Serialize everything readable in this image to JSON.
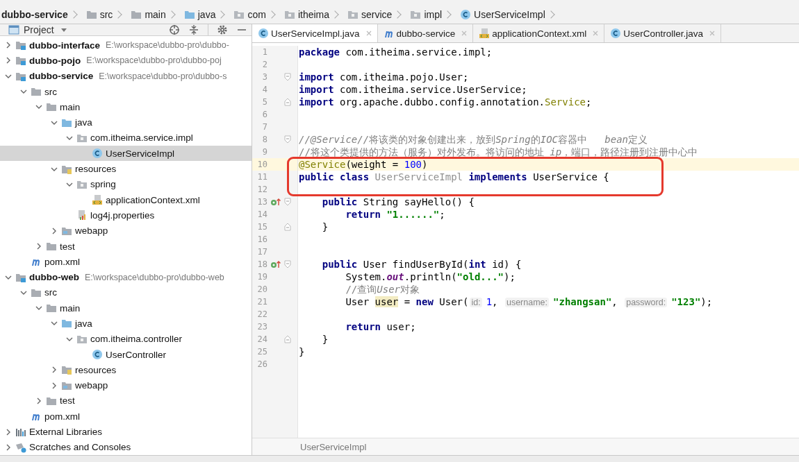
{
  "breadcrumb": [
    {
      "label": "dubbo-service",
      "kind": "module"
    },
    {
      "label": "src",
      "kind": "folder"
    },
    {
      "label": "main",
      "kind": "folder"
    },
    {
      "label": "java",
      "kind": "source"
    },
    {
      "label": "com",
      "kind": "package"
    },
    {
      "label": "itheima",
      "kind": "package"
    },
    {
      "label": "service",
      "kind": "package"
    },
    {
      "label": "impl",
      "kind": "package"
    },
    {
      "label": "UserServiceImpl",
      "kind": "class"
    }
  ],
  "project_panel": {
    "title": "Project",
    "tree": [
      {
        "name": "dubbo-interface",
        "path": "E:\\workspace\\dubbo-pro\\dubbo-",
        "kind": "module",
        "expanded": false,
        "selected": false
      },
      {
        "name": "dubbo-pojo",
        "path": "E:\\workspace\\dubbo-pro\\dubbo-poj",
        "kind": "module",
        "expanded": false,
        "selected": false
      },
      {
        "name": "dubbo-service",
        "path": "E:\\workspace\\dubbo-pro\\dubbo-s",
        "kind": "module",
        "expanded": true,
        "selected": false,
        "children": [
          {
            "name": "src",
            "kind": "folder",
            "expanded": true,
            "selected": false,
            "children": [
              {
                "name": "main",
                "kind": "folder",
                "expanded": true,
                "selected": false,
                "children": [
                  {
                    "name": "java",
                    "kind": "source",
                    "expanded": true,
                    "selected": false,
                    "children": [
                      {
                        "name": "com.itheima.service.impl",
                        "kind": "package",
                        "expanded": true,
                        "selected": false,
                        "children": [
                          {
                            "name": "UserServiceImpl",
                            "kind": "class",
                            "selected": true
                          }
                        ]
                      }
                    ]
                  },
                  {
                    "name": "resources",
                    "kind": "resources",
                    "expanded": true,
                    "selected": false,
                    "children": [
                      {
                        "name": "spring",
                        "kind": "package",
                        "expanded": true,
                        "selected": false,
                        "children": [
                          {
                            "name": "applicationContext.xml",
                            "kind": "xml",
                            "selected": false
                          }
                        ]
                      },
                      {
                        "name": "log4j.properties",
                        "kind": "properties",
                        "selected": false
                      }
                    ]
                  },
                  {
                    "name": "webapp",
                    "kind": "web",
                    "expanded": false,
                    "selected": false
                  }
                ]
              },
              {
                "name": "test",
                "kind": "folder",
                "expanded": false,
                "selected": false
              }
            ]
          },
          {
            "name": "pom.xml",
            "kind": "maven",
            "selected": false
          }
        ]
      },
      {
        "name": "dubbo-web",
        "path": "E:\\workspace\\dubbo-pro\\dubbo-web",
        "kind": "module",
        "expanded": true,
        "selected": false,
        "children": [
          {
            "name": "src",
            "kind": "folder",
            "expanded": true,
            "selected": false,
            "children": [
              {
                "name": "main",
                "kind": "folder",
                "expanded": true,
                "selected": false,
                "children": [
                  {
                    "name": "java",
                    "kind": "source",
                    "expanded": true,
                    "selected": false,
                    "children": [
                      {
                        "name": "com.itheima.controller",
                        "kind": "package",
                        "expanded": true,
                        "selected": false,
                        "children": [
                          {
                            "name": "UserController",
                            "kind": "class",
                            "selected": false
                          }
                        ]
                      }
                    ]
                  },
                  {
                    "name": "resources",
                    "kind": "resources",
                    "expanded": false,
                    "selected": false
                  },
                  {
                    "name": "webapp",
                    "kind": "web",
                    "expanded": false,
                    "selected": false
                  }
                ]
              },
              {
                "name": "test",
                "kind": "folder",
                "expanded": false,
                "selected": false
              }
            ]
          },
          {
            "name": "pom.xml",
            "kind": "maven",
            "selected": false
          }
        ]
      },
      {
        "name": "External Libraries",
        "kind": "libraries",
        "expanded": false,
        "selected": false
      },
      {
        "name": "Scratches and Consoles",
        "kind": "scratches",
        "expanded": false,
        "selected": false
      }
    ]
  },
  "tabs": [
    {
      "label": "UserServiceImpl.java",
      "kind": "class",
      "selected": true
    },
    {
      "label": "dubbo-service",
      "kind": "maven",
      "selected": false
    },
    {
      "label": "applicationContext.xml",
      "kind": "xml",
      "selected": false
    },
    {
      "label": "UserController.java",
      "kind": "class",
      "selected": false
    }
  ],
  "code": {
    "lines": [
      {
        "number": "1",
        "tokens": [
          {
            "kind": "kw",
            "text": "package"
          },
          {
            "kind": "plain",
            "text": " com.itheima.service.impl;"
          }
        ]
      },
      {
        "number": "2"
      },
      {
        "number": "3",
        "fold_start": true,
        "tokens": [
          {
            "kind": "kw",
            "text": "import"
          },
          {
            "kind": "plain",
            "text": " com.itheima.pojo.User;"
          }
        ]
      },
      {
        "number": "4",
        "tokens": [
          {
            "kind": "kw",
            "text": "import"
          },
          {
            "kind": "plain",
            "text": " com.itheima.service.UserService;"
          }
        ]
      },
      {
        "number": "5",
        "fold_end": true,
        "tokens": [
          {
            "kind": "kw",
            "text": "import"
          },
          {
            "kind": "plain",
            "text": " org.apache.dubbo.config.annotation."
          },
          {
            "kind": "ann",
            "text": "Service"
          },
          {
            "kind": "plain",
            "text": ";"
          }
        ]
      },
      {
        "number": "6"
      },
      {
        "number": "7"
      },
      {
        "number": "8",
        "fold_start": true,
        "tokens": [
          {
            "kind": "comment_em",
            "text": "//@Service//"
          },
          {
            "kind": "comment",
            "text": "将该类的对象创建出来，放到"
          },
          {
            "kind": "comment_em",
            "text": "Spring"
          },
          {
            "kind": "comment",
            "text": "的"
          },
          {
            "kind": "comment_em",
            "text": "IOC"
          },
          {
            "kind": "comment",
            "text": "容器中   "
          },
          {
            "kind": "comment_em",
            "text": "bean"
          },
          {
            "kind": "comment",
            "text": "定义"
          }
        ]
      },
      {
        "number": "9",
        "tokens": [
          {
            "kind": "comment",
            "text": "//将这个类提供的方法（服务）对外发布。将访问的地址 "
          },
          {
            "kind": "comment_em",
            "text": "ip"
          },
          {
            "kind": "comment",
            "text": "，端口，路径注册到注册中心中"
          }
        ]
      },
      {
        "number": "10",
        "current": true,
        "tokens": [
          {
            "kind": "ann",
            "text": "@Service"
          },
          {
            "kind": "plain",
            "text": "(weight = "
          },
          {
            "kind": "num",
            "text": "100"
          },
          {
            "kind": "plain",
            "text": ")"
          }
        ]
      },
      {
        "number": "11",
        "tokens": [
          {
            "kind": "kw",
            "text": "public class "
          },
          {
            "kind": "unused",
            "text": "UserServiceImpl "
          },
          {
            "kind": "kw",
            "text": "implements"
          },
          {
            "kind": "plain",
            "text": " UserService {"
          }
        ]
      },
      {
        "number": "12"
      },
      {
        "number": "13",
        "implements": true,
        "fold_start": true,
        "tokens": [
          {
            "kind": "kw",
            "text": "    public"
          },
          {
            "kind": "plain",
            "text": " String sayHello() {"
          }
        ]
      },
      {
        "number": "14",
        "tokens": [
          {
            "kind": "kw",
            "text": "        return "
          },
          {
            "kind": "str",
            "text": "\"1......\""
          },
          {
            "kind": "plain",
            "text": ";"
          }
        ]
      },
      {
        "number": "15",
        "fold_end": true,
        "tokens": [
          {
            "kind": "plain",
            "text": "    }"
          }
        ]
      },
      {
        "number": "16"
      },
      {
        "number": "17"
      },
      {
        "number": "18",
        "implements": true,
        "fold_start": true,
        "tokens": [
          {
            "kind": "kw",
            "text": "    public"
          },
          {
            "kind": "plain",
            "text": " User findUserById("
          },
          {
            "kind": "kw",
            "text": "int"
          },
          {
            "kind": "plain",
            "text": " id) {"
          }
        ]
      },
      {
        "number": "19",
        "tokens": [
          {
            "kind": "plain",
            "text": "        System."
          },
          {
            "kind": "field",
            "text": "out"
          },
          {
            "kind": "plain",
            "text": ".println("
          },
          {
            "kind": "str",
            "text": "\"old...\""
          },
          {
            "kind": "plain",
            "text": ");"
          }
        ]
      },
      {
        "number": "20",
        "tokens": [
          {
            "kind": "comment",
            "text": "        //查询"
          },
          {
            "kind": "comment_em",
            "text": "User"
          },
          {
            "kind": "comment",
            "text": "对象"
          }
        ]
      },
      {
        "number": "21",
        "tokens": [
          {
            "kind": "plain",
            "text": "        User "
          },
          {
            "kind": "var",
            "text": "user"
          },
          {
            "kind": "plain",
            "text": " = "
          },
          {
            "kind": "kw",
            "text": "new"
          },
          {
            "kind": "plain",
            "text": " User("
          },
          {
            "kind": "hint",
            "text": "id:"
          },
          {
            "kind": "num",
            "text": "1"
          },
          {
            "kind": "plain",
            "text": ", "
          },
          {
            "kind": "hint",
            "text": "username:"
          },
          {
            "kind": "str",
            "text": "\"zhangsan\""
          },
          {
            "kind": "plain",
            "text": ", "
          },
          {
            "kind": "hint",
            "text": "password:"
          },
          {
            "kind": "str",
            "text": "\"123\""
          },
          {
            "kind": "plain",
            "text": ");"
          }
        ]
      },
      {
        "number": "22"
      },
      {
        "number": "23",
        "tokens": [
          {
            "kind": "kw",
            "text": "        return"
          },
          {
            "kind": "plain",
            "text": " user;"
          }
        ]
      },
      {
        "number": "24",
        "fold_end": true,
        "tokens": [
          {
            "kind": "plain",
            "text": "    }"
          }
        ]
      },
      {
        "number": "25",
        "tokens": [
          {
            "kind": "plain",
            "text": "}"
          }
        ]
      },
      {
        "number": "26"
      }
    ],
    "annotation": {
      "kind": "rectangle",
      "color": "#e5392d"
    }
  },
  "editor_breadcrumb": "UserServiceImpl"
}
